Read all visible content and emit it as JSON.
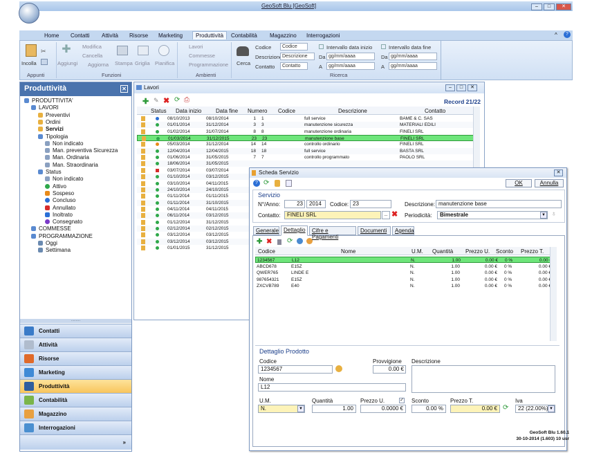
{
  "app": {
    "title": "GeoSoft Blu [GeoSoft]"
  },
  "ribbon": {
    "tabs": [
      "Home",
      "Contatti",
      "Attività",
      "Risorse",
      "Marketing",
      "Produttività",
      "Contabilità",
      "Magazzino",
      "Interrogazioni"
    ],
    "active_tab": "Produttività",
    "appunti": {
      "group": "Appunti",
      "incolla": "Incolla"
    },
    "funzioni": {
      "group": "Funzioni",
      "aggiungi": "Aggiungi",
      "modifica": "Modifica",
      "cancella": "Cancella",
      "aggiorna": "Aggiorna",
      "stampa": "Stampa",
      "griglia": "Griglia",
      "pianifica": "Pianifica"
    },
    "ambienti": {
      "group": "Ambienti",
      "lavori": "Lavori",
      "commesse": "Commesse",
      "programmazione": "Programmazione"
    },
    "cerca": "Cerca",
    "ricerca": {
      "group": "Ricerca",
      "codice_lbl": "Codice",
      "codice_ph": "Codice",
      "descrizione_lbl": "Descrizione",
      "descrizione_ph": "Descrizione",
      "contatto_lbl": "Contatto",
      "contatto_ph": "Contatto",
      "intervallo_inizio": "Intervallo data inizio",
      "intervallo_fine": "Intervallo data fine",
      "da": "Da",
      "a": "A",
      "date_ph": "gg/mm/aaaa"
    }
  },
  "left": {
    "title": "Produttività",
    "tree": [
      {
        "label": "PRODUTTIVITA'",
        "level": 0,
        "icon": "folder-icon"
      },
      {
        "label": "LAVORI",
        "level": 1,
        "icon": "folder-icon"
      },
      {
        "label": "Preventivi",
        "level": 2,
        "icon": "preventivi-icon"
      },
      {
        "label": "Ordini",
        "level": 2,
        "icon": "ordini-icon"
      },
      {
        "label": "Servizi",
        "level": 2,
        "icon": "servizi-icon",
        "bold": true
      },
      {
        "label": "Tipologia",
        "level": 2,
        "icon": "tipologia-icon"
      },
      {
        "label": "Non indicato",
        "level": 3,
        "icon": "filter-icon"
      },
      {
        "label": "Man. preventiva Sicurezza",
        "level": 3,
        "icon": "filter-icon"
      },
      {
        "label": "Man. Ordinaria",
        "level": 3,
        "icon": "filter-icon"
      },
      {
        "label": "Man. Straordinaria",
        "level": 3,
        "icon": "filter-icon"
      },
      {
        "label": "Status",
        "level": 2,
        "icon": "status-icon"
      },
      {
        "label": "Non indicato",
        "level": 3,
        "icon": "filter-icon"
      },
      {
        "label": "Attivo",
        "level": 3,
        "icon": "green-dot-icon"
      },
      {
        "label": "Sospeso",
        "level": 3,
        "icon": "pause-icon"
      },
      {
        "label": "Concluso",
        "level": 3,
        "icon": "blue-dot-icon"
      },
      {
        "label": "Annullato",
        "level": 3,
        "icon": "red-square-icon"
      },
      {
        "label": "Inoltrato",
        "level": 3,
        "icon": "arrow-icon"
      },
      {
        "label": "Consegnato",
        "level": 3,
        "icon": "purple-dot-icon"
      },
      {
        "label": "COMMESSE",
        "level": 1,
        "icon": "folder-icon"
      },
      {
        "label": "PROGRAMMAZIONE",
        "level": 1,
        "icon": "folder-icon"
      },
      {
        "label": "Oggi",
        "level": 2,
        "icon": "calendar-icon"
      },
      {
        "label": "Settimana",
        "level": 2,
        "icon": "calendar-icon"
      }
    ],
    "nav": [
      {
        "label": "Contatti",
        "color": "#3a7bc8"
      },
      {
        "label": "Attività",
        "color": "#b0bccd"
      },
      {
        "label": "Risorse",
        "color": "#e06a2a"
      },
      {
        "label": "Marketing",
        "color": "#3f8ad6"
      },
      {
        "label": "Produttività",
        "color": "#2f5e9e",
        "active": true
      },
      {
        "label": "Contabilità",
        "color": "#7ab54a"
      },
      {
        "label": "Magazzino",
        "color": "#e8a040"
      },
      {
        "label": "Interrogazioni",
        "color": "#4a8fd0"
      }
    ],
    "more": "»"
  },
  "lavori": {
    "title": "Lavori",
    "record": "Record 21/22",
    "columns": [
      "Status",
      "Data inizio",
      "Data fine",
      "Numero",
      "Codice",
      "Descrizione",
      "Contatto"
    ],
    "rows": [
      {
        "status": "#2b6fd6",
        "inizio": "08/10/2013",
        "fine": "08/10/2014",
        "numero": "1",
        "codice": "1",
        "descrizione": "full service",
        "contatto": "BAME & C. SAS"
      },
      {
        "status": "#2ea84a",
        "inizio": "01/01/2014",
        "fine": "31/12/2014",
        "numero": "3",
        "codice": "3",
        "descrizione": "manutenzione sicurezza",
        "contatto": "MATERIALI EDILI"
      },
      {
        "status": "#2ea84a",
        "inizio": "01/02/2014",
        "fine": "31/07/2014",
        "numero": "8",
        "codice": "8",
        "descrizione": "manutenzione ordinaria",
        "contatto": "FINELI SRL"
      },
      {
        "status": "#2ea84a",
        "inizio": "01/03/2014",
        "fine": "31/12/2015",
        "numero": "23",
        "codice": "23",
        "descrizione": "manutenzione base",
        "contatto": "FINELI SRL",
        "selected": true
      },
      {
        "status": "#e88a1a",
        "inizio": "05/03/2014",
        "fine": "31/12/2014",
        "numero": "14",
        "codice": "14",
        "descrizione": "controllo ordinario",
        "contatto": "FINELI SRL"
      },
      {
        "status": "#2ea84a",
        "inizio": "12/04/2014",
        "fine": "12/04/2015",
        "numero": "18",
        "codice": "18",
        "descrizione": "full service",
        "contatto": "BASTA SRL"
      },
      {
        "status": "#2ea84a",
        "inizio": "01/06/2014",
        "fine": "31/05/2015",
        "numero": "7",
        "codice": "7",
        "descrizione": "controllo programmato",
        "contatto": "PAOLO SRL"
      },
      {
        "status": "#2ea84a",
        "inizio": "18/06/2014",
        "fine": "31/05/2015",
        "numero": "",
        "codice": "",
        "descrizione": "",
        "contatto": ""
      },
      {
        "status": "#d62b2b",
        "inizio": "03/07/2014",
        "fine": "03/07/2014",
        "numero": "",
        "codice": "",
        "descrizione": "",
        "contatto": ""
      },
      {
        "status": "#2ea84a",
        "inizio": "01/10/2014",
        "fine": "03/12/2015",
        "numero": "",
        "codice": "",
        "descrizione": "",
        "contatto": ""
      },
      {
        "status": "#2ea84a",
        "inizio": "03/10/2014",
        "fine": "04/11/2015",
        "numero": "",
        "codice": "",
        "descrizione": "",
        "contatto": ""
      },
      {
        "status": "#2ea84a",
        "inizio": "24/10/2014",
        "fine": "24/10/2015",
        "numero": "",
        "codice": "",
        "descrizione": "",
        "contatto": ""
      },
      {
        "status": "#2ea84a",
        "inizio": "01/11/2014",
        "fine": "01/11/2015",
        "numero": "",
        "codice": "",
        "descrizione": "",
        "contatto": ""
      },
      {
        "status": "#2ea84a",
        "inizio": "01/11/2014",
        "fine": "31/10/2015",
        "numero": "",
        "codice": "",
        "descrizione": "",
        "contatto": ""
      },
      {
        "status": "#2ea84a",
        "inizio": "04/11/2014",
        "fine": "04/11/2015",
        "numero": "",
        "codice": "",
        "descrizione": "",
        "contatto": ""
      },
      {
        "status": "#2ea84a",
        "inizio": "06/11/2014",
        "fine": "03/12/2015",
        "numero": "",
        "codice": "",
        "descrizione": "",
        "contatto": ""
      },
      {
        "status": "#2ea84a",
        "inizio": "01/12/2014",
        "fine": "31/12/2015",
        "numero": "",
        "codice": "",
        "descrizione": "",
        "contatto": ""
      },
      {
        "status": "#2ea84a",
        "inizio": "02/12/2014",
        "fine": "02/12/2015",
        "numero": "",
        "codice": "",
        "descrizione": "",
        "contatto": ""
      },
      {
        "status": "#2ea84a",
        "inizio": "03/12/2014",
        "fine": "03/12/2015",
        "numero": "",
        "codice": "",
        "descrizione": "",
        "contatto": ""
      },
      {
        "status": "#2ea84a",
        "inizio": "03/12/2014",
        "fine": "03/12/2015",
        "numero": "",
        "codice": "",
        "descrizione": "",
        "contatto": ""
      },
      {
        "status": "#2ea84a",
        "inizio": "01/01/2015",
        "fine": "31/12/2015",
        "numero": "",
        "codice": "",
        "descrizione": "",
        "contatto": ""
      }
    ]
  },
  "scheda": {
    "title": "Scheda Servizio",
    "ok": "OK",
    "annulla": "Annulla",
    "servizio": "Servizio",
    "nanno_lbl": "N°/Anno:",
    "numero": "23",
    "anno": "2014",
    "codice_lbl": "Codice:",
    "codice": "23",
    "descrizione_lbl": "Descrizione:",
    "descrizione": "manutenzione base",
    "contatto_lbl": "Contatto:",
    "contatto": "FINELI SRL",
    "dots": "...",
    "periodicita_lbl": "Periodicità:",
    "periodicita": "Bimestrale",
    "tabs": [
      "Generale",
      "Dettaglio",
      "Cifre e Pagamenti",
      "Documenti",
      "Agenda"
    ],
    "active_tab": "Dettaglio",
    "det_columns": [
      "Codice",
      "Nome",
      "U.M.",
      "Quantità",
      "Prezzo U.",
      "Sconto",
      "Prezzo T."
    ],
    "det_rows": [
      {
        "codice": "1234567",
        "nome": "L12",
        "um": "N.",
        "qta": "1.00",
        "prezzo": "0.00 €",
        "sconto": "0 %",
        "totale": "0.00 €",
        "selected": true
      },
      {
        "codice": "ABCD678",
        "nome": "E15Z",
        "um": "N.",
        "qta": "1.00",
        "prezzo": "0.00 €",
        "sconto": "0 %",
        "totale": "0.00 €"
      },
      {
        "codice": "QWER765",
        "nome": "LINDE E",
        "um": "N.",
        "qta": "1.00",
        "prezzo": "0.00 €",
        "sconto": "0 %",
        "totale": "0.00 €"
      },
      {
        "codice": "987654321",
        "nome": "E15Z",
        "um": "N.",
        "qta": "1.00",
        "prezzo": "0.00 €",
        "sconto": "0 %",
        "totale": "0.00 €"
      },
      {
        "codice": "ZXCVB789",
        "nome": "E40",
        "um": "N.",
        "qta": "1.00",
        "prezzo": "0.00 €",
        "sconto": "0 %",
        "totale": "0.00 €"
      }
    ],
    "dettaglio": {
      "title": "Dettaglio Prodotto",
      "codice_lbl": "Codice",
      "codice": "1234567",
      "provvigione_lbl": "Provvigione",
      "provvigione": "0.00 €",
      "descrizione_lbl": "Descrizione",
      "nome_lbl": "Nome",
      "nome": "L12",
      "um_lbl": "U.M.",
      "um": "N.",
      "quantita_lbl": "Quantità",
      "quantita": "1.00",
      "prezzo_lbl": "Prezzo U.",
      "prezzo": "0.0000 €",
      "sconto_lbl": "Sconto",
      "sconto": "0.00 %",
      "prezzot_lbl": "Prezzo T.",
      "prezzot": "0.00 €",
      "iva_lbl": "Iva",
      "iva": "22 (22.00%)"
    }
  },
  "footer": {
    "version": "GeoSoft Blu 1.60.1",
    "build": "30-10-2014 (1.603) 10 usr"
  }
}
